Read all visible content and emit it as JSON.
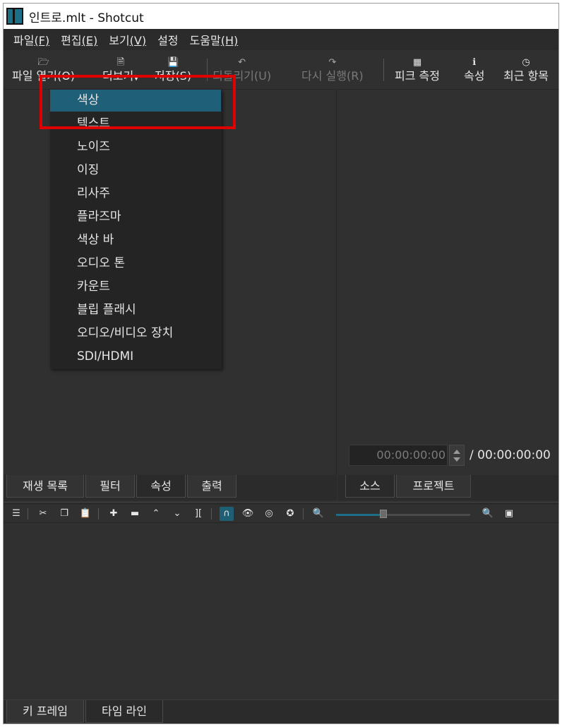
{
  "window": {
    "title": "인트로.mlt - Shotcut"
  },
  "menubar": [
    {
      "label": "파일",
      "accel": "(F)"
    },
    {
      "label": "편집",
      "accel": "(E)"
    },
    {
      "label": "보기",
      "accel": "(V)"
    },
    {
      "label": "설정",
      "accel": ""
    },
    {
      "label": "도움말",
      "accel": "(H)"
    }
  ],
  "toolbar": {
    "open_file": "파일 열기(O)",
    "open_other": "더보기",
    "save": "저장(S)",
    "undo": "되돌리기(U)",
    "redo": "다시 실행(R)",
    "peak_meter": "피크 측정",
    "properties": "속성",
    "recent": "최근 항목"
  },
  "open_other_menu": {
    "items": [
      "색상",
      "텍스트",
      "노이즈",
      "이징",
      "리사주",
      "플라즈마",
      "색상 바",
      "오디오 톤",
      "카운트",
      "블립 플래시",
      "오디오/비디오 장치",
      "SDI/HDMI"
    ],
    "highlighted": "색상"
  },
  "player": {
    "timecode": "00:00:00:00",
    "duration": "/ 00:00:00:00"
  },
  "left_tabs": [
    "재생 목록",
    "필터",
    "속성",
    "출력"
  ],
  "right_tabs": [
    "소스",
    "프로젝트"
  ],
  "bottom_tabs": [
    "키 프레임",
    "타임 라인"
  ],
  "timeline_toolbar": {
    "icons": [
      "menu-icon",
      "cut-icon",
      "copy-icon",
      "paste-icon",
      "append-icon",
      "remove-icon",
      "lift-icon",
      "overwrite-icon",
      "split-icon",
      "snap-icon",
      "scrub-icon",
      "ripple-icon",
      "ripple-all-icon",
      "zoom-out-icon",
      "zoom-in-icon",
      "zoom-fit-icon"
    ],
    "snap_active": true,
    "zoom_level": 0.35
  },
  "colors": {
    "accent": "#1f5f78",
    "annotation": "#e00000"
  }
}
